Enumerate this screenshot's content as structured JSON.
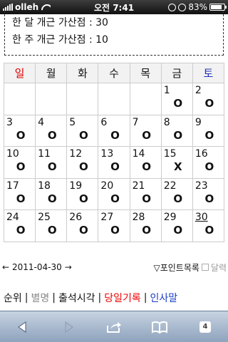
{
  "status_bar": {
    "carrier": "olleh",
    "time": "오전 7:41",
    "battery": "83%"
  },
  "info": {
    "line1": "한 달 개근 가산점 : 30",
    "line2": "한 주 개근 가산점 : 10"
  },
  "calendar": {
    "weekdays": [
      "일",
      "월",
      "화",
      "수",
      "목",
      "금",
      "토"
    ],
    "weeks": [
      [
        null,
        null,
        null,
        null,
        null,
        {
          "d": "1",
          "m": "O"
        },
        {
          "d": "2",
          "m": "O"
        }
      ],
      [
        {
          "d": "3",
          "m": "O"
        },
        {
          "d": "4",
          "m": "O"
        },
        {
          "d": "5",
          "m": "O"
        },
        {
          "d": "6",
          "m": "O"
        },
        {
          "d": "7",
          "m": "O"
        },
        {
          "d": "8",
          "m": "O"
        },
        {
          "d": "9",
          "m": "O"
        }
      ],
      [
        {
          "d": "10",
          "m": "O"
        },
        {
          "d": "11",
          "m": "O"
        },
        {
          "d": "12",
          "m": "O"
        },
        {
          "d": "13",
          "m": "O"
        },
        {
          "d": "14",
          "m": "O"
        },
        {
          "d": "15",
          "m": "X"
        },
        {
          "d": "16",
          "m": "O"
        }
      ],
      [
        {
          "d": "17",
          "m": "O"
        },
        {
          "d": "18",
          "m": "O"
        },
        {
          "d": "19",
          "m": "O"
        },
        {
          "d": "20",
          "m": "O"
        },
        {
          "d": "21",
          "m": "O"
        },
        {
          "d": "22",
          "m": "O"
        },
        {
          "d": "23",
          "m": "O"
        }
      ],
      [
        {
          "d": "24",
          "m": "O"
        },
        {
          "d": "25",
          "m": "O"
        },
        {
          "d": "26",
          "m": "O"
        },
        {
          "d": "27",
          "m": "O"
        },
        {
          "d": "28",
          "m": "O"
        },
        {
          "d": "29",
          "m": "O"
        },
        {
          "d": "30",
          "m": "O",
          "today": true
        }
      ]
    ]
  },
  "nav": {
    "prev": "←",
    "date": "2011-04-30",
    "next": "→",
    "points_list": "▽포인트목록",
    "calendar_label": "달력"
  },
  "menu": {
    "ranking": "순위",
    "alias": "별명",
    "attendance_time": "출석시각",
    "today_record": "당일기록",
    "greeting": "인사말"
  },
  "toolbar": {
    "tabs_count": "4"
  },
  "colors": {
    "sunday": "#dd0000",
    "saturday": "#2233bb",
    "accent_red": "#ee0000",
    "accent_blue": "#1a3cc8"
  }
}
